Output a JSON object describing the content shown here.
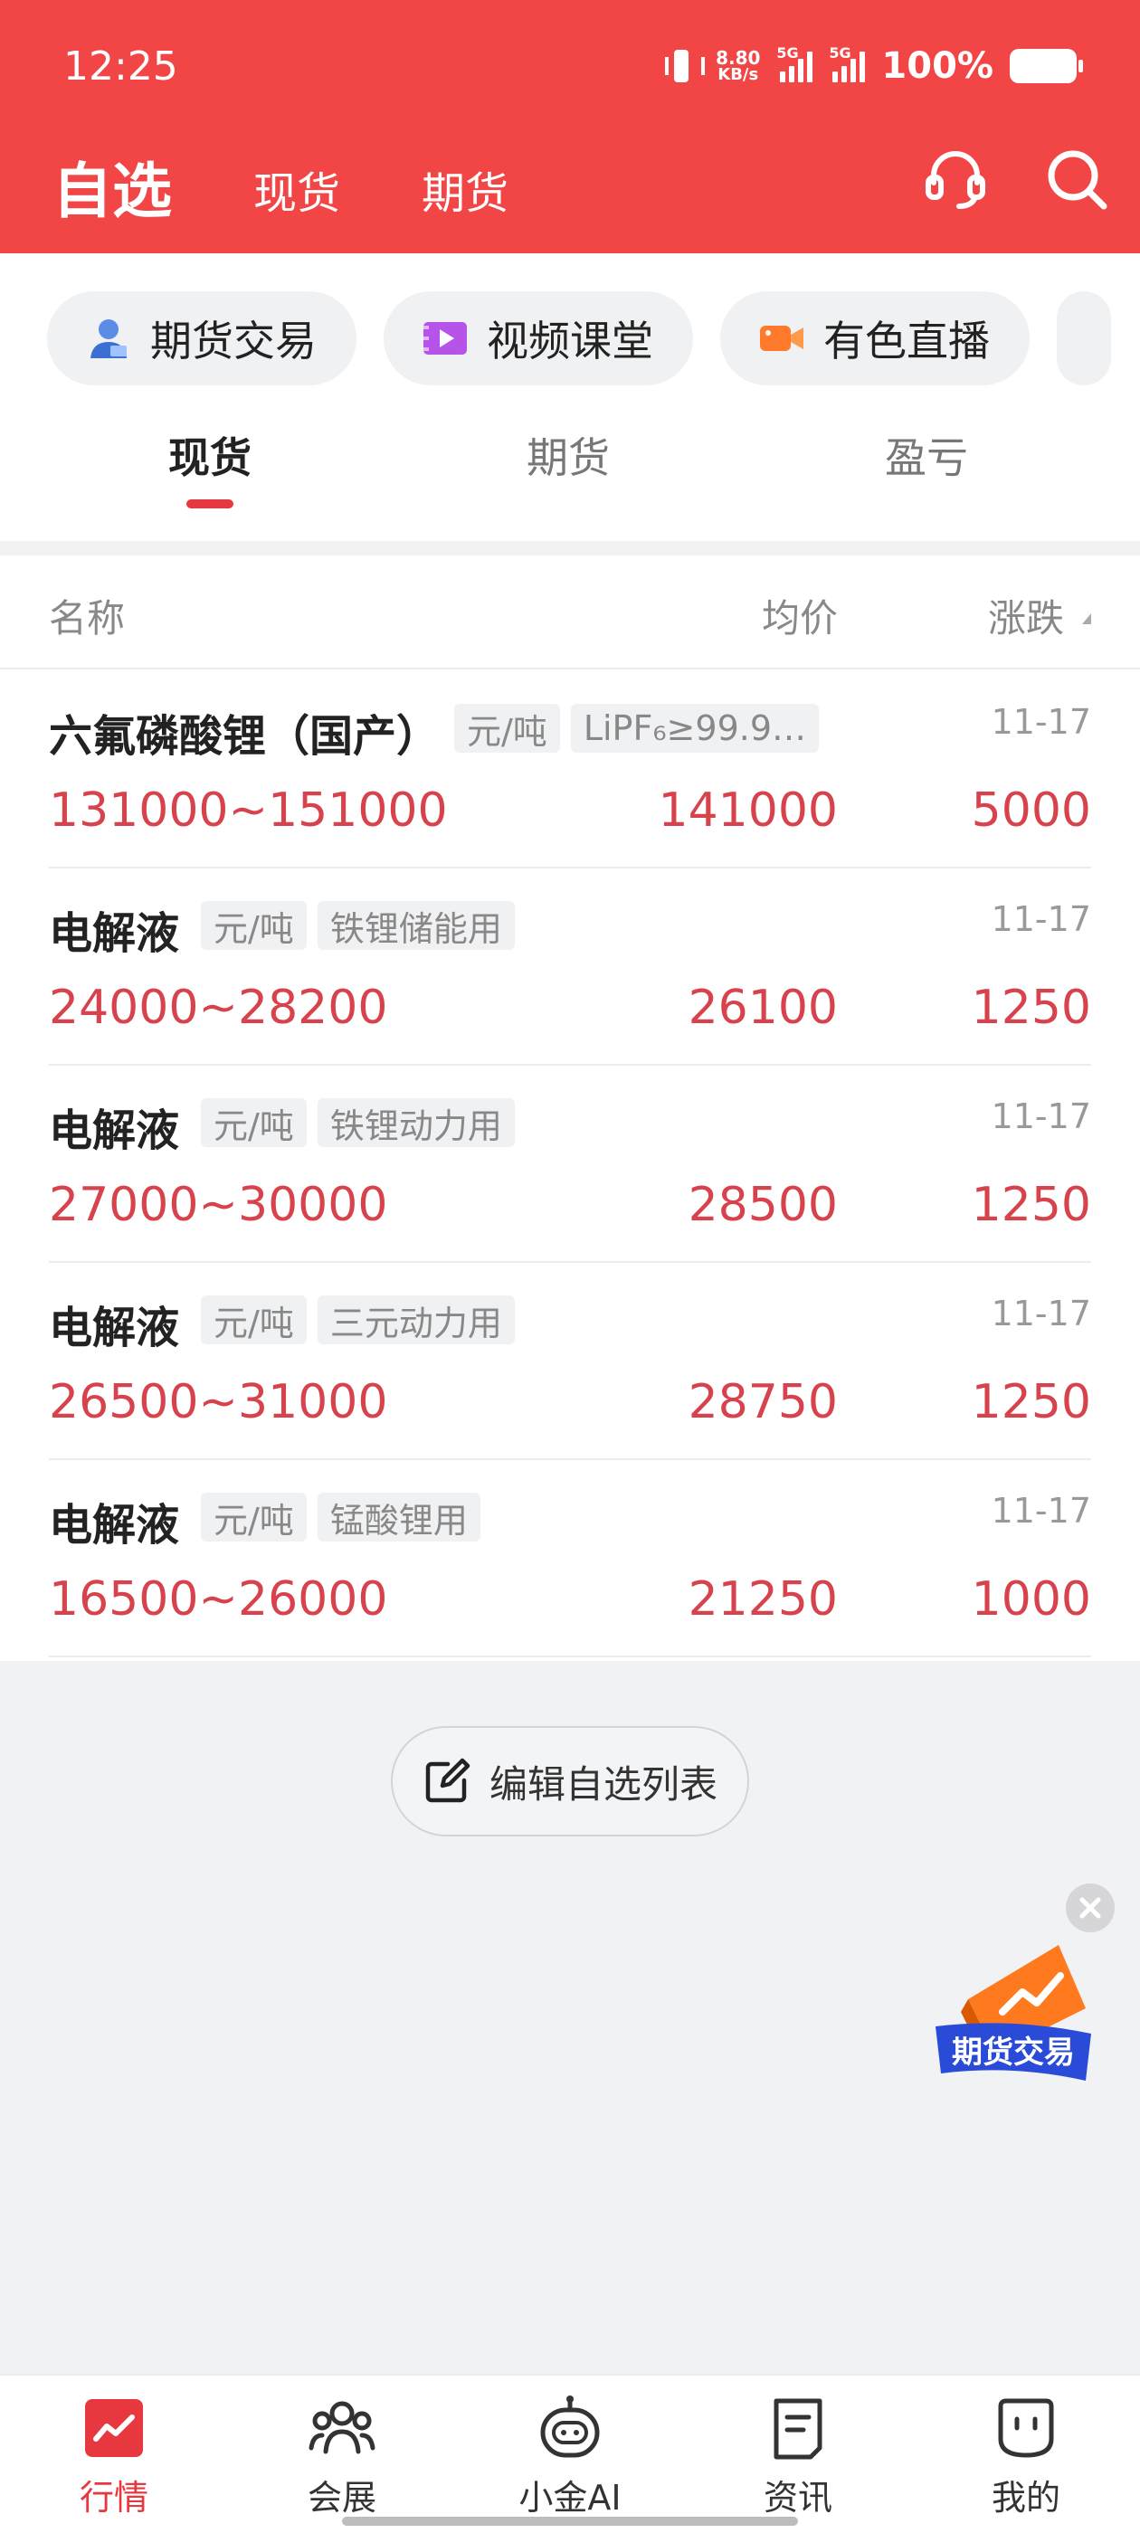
{
  "status_bar": {
    "time": "12:25",
    "net_speed_value": "8.80",
    "net_speed_unit": "KB/s",
    "signal1_label": "5G",
    "signal2_label": "5G",
    "battery": "100%"
  },
  "header": {
    "title": "自选",
    "tabs": [
      "现货",
      "期货"
    ],
    "icons": [
      "support-icon",
      "search-icon"
    ]
  },
  "pills": [
    {
      "label": "期货交易",
      "icon": "trader-icon"
    },
    {
      "label": "视频课堂",
      "icon": "video-icon"
    },
    {
      "label": "有色直播",
      "icon": "live-camera-icon"
    }
  ],
  "subtabs": {
    "items": [
      "现货",
      "期货",
      "盈亏"
    ],
    "active_index": 0
  },
  "list": {
    "columns": {
      "name": "名称",
      "avg": "均价",
      "change": "涨跌"
    },
    "rows": [
      {
        "name": "六氟磷酸锂（国产）",
        "unit": "元/吨",
        "spec": "LiPF₆≥99.9…",
        "date": "11-17",
        "range": "131000~151000",
        "avg": "141000",
        "change": "5000"
      },
      {
        "name": "电解液",
        "unit": "元/吨",
        "spec": "铁锂储能用",
        "date": "11-17",
        "range": "24000~28200",
        "avg": "26100",
        "change": "1250"
      },
      {
        "name": "电解液",
        "unit": "元/吨",
        "spec": "铁锂动力用",
        "date": "11-17",
        "range": "27000~30000",
        "avg": "28500",
        "change": "1250"
      },
      {
        "name": "电解液",
        "unit": "元/吨",
        "spec": "三元动力用",
        "date": "11-17",
        "range": "26500~31000",
        "avg": "28750",
        "change": "1250"
      },
      {
        "name": "电解液",
        "unit": "元/吨",
        "spec": "锰酸锂用",
        "date": "11-17",
        "range": "16500~26000",
        "avg": "21250",
        "change": "1000"
      }
    ]
  },
  "edit_button": {
    "label": "编辑自选列表"
  },
  "float_ad": {
    "label": "期货交易"
  },
  "bottom_nav": {
    "items": [
      {
        "label": "行情",
        "icon": "market-chart-icon"
      },
      {
        "label": "会展",
        "icon": "people-icon"
      },
      {
        "label": "小金AI",
        "icon": "robot-icon"
      },
      {
        "label": "资讯",
        "icon": "news-icon"
      },
      {
        "label": "我的",
        "icon": "profile-icon"
      }
    ],
    "active_index": 0
  },
  "colors": {
    "header_bg": "#f24646",
    "price_red": "#d7424c",
    "accent": "#e8383f"
  }
}
